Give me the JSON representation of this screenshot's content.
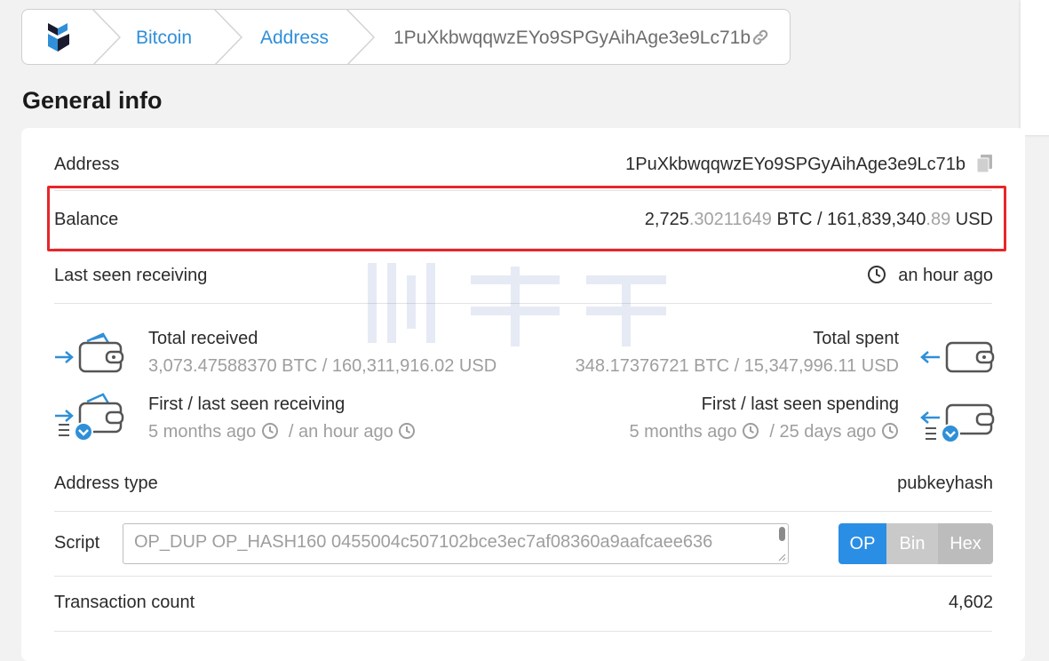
{
  "breadcrumb": {
    "items": [
      "Bitcoin",
      "Address"
    ],
    "address": "1PuXkbwqqwzEYo9SPGyAihAge3e9Lc71b"
  },
  "section_title": "General info",
  "info": {
    "address_label": "Address",
    "address_value": "1PuXkbwqqwzEYo9SPGyAihAge3e9Lc71b",
    "balance_label": "Balance",
    "balance_btc_int": "2,725",
    "balance_btc_dec": ".30211649",
    "balance_btc_unit": "BTC /",
    "balance_usd_int": "161,839,340",
    "balance_usd_dec": ".89",
    "balance_usd_unit": "USD",
    "last_seen_label": "Last seen receiving",
    "last_seen_value": "an hour ago",
    "total_received_label": "Total received",
    "total_received_value": "3,073.47588370 BTC / 160,311,916.02 USD",
    "total_spent_label": "Total spent",
    "total_spent_value": "348.17376721 BTC / 15,347,996.11 USD",
    "first_last_receiving_label": "First / last seen receiving",
    "first_receiving": "5 months ago",
    "last_receiving": "/ an hour ago",
    "first_last_spending_label": "First / last seen spending",
    "first_spending": "5 months ago",
    "last_spending": "/ 25 days ago",
    "address_type_label": "Address type",
    "address_type_value": "pubkeyhash",
    "script_label": "Script",
    "script_value": "OP_DUP OP_HASH160 0455004c507102bce3ec7af08360a9aafcaee636",
    "script_modes": [
      "OP",
      "Bin",
      "Hex"
    ],
    "tx_count_label": "Transaction count",
    "tx_count_value": "4,602"
  },
  "colors": {
    "accent": "#2f8fd8",
    "highlight": "#e6262a",
    "toggle_active": "#2b8ee5"
  }
}
